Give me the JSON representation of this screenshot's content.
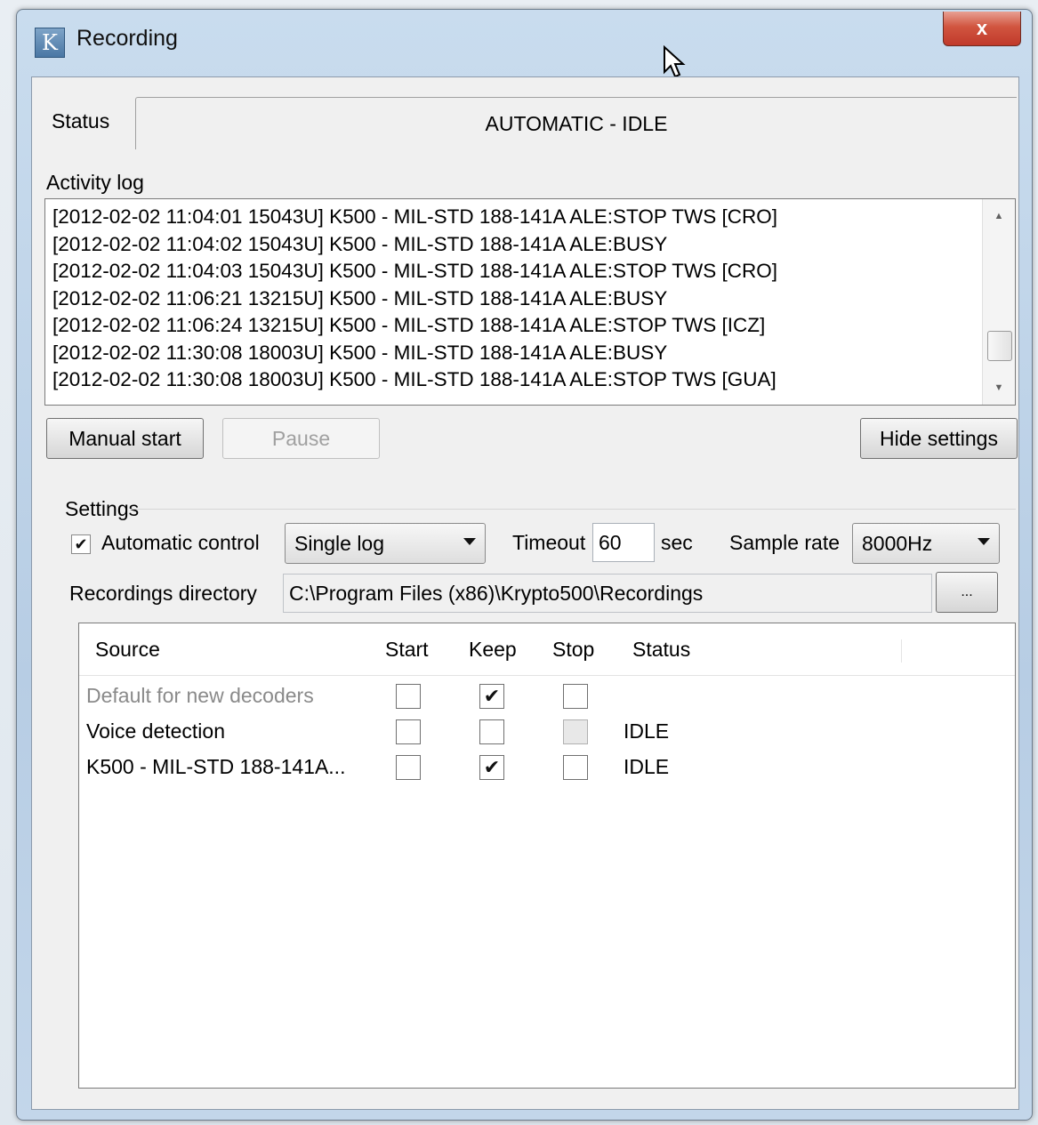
{
  "window": {
    "title": "Recording",
    "app_icon_letter": "K",
    "close_glyph": "x"
  },
  "status": {
    "label": "Status",
    "value": "AUTOMATIC - IDLE"
  },
  "activity_log": {
    "label": "Activity log",
    "lines": [
      "[2012-02-02 11:04:01 15043U] K500 - MIL-STD 188-141A ALE:STOP TWS [CRO]",
      "[2012-02-02 11:04:02 15043U] K500 - MIL-STD 188-141A ALE:BUSY",
      "[2012-02-02 11:04:03 15043U] K500 - MIL-STD 188-141A ALE:STOP TWS [CRO]",
      "[2012-02-02 11:06:21 13215U] K500 - MIL-STD 188-141A ALE:BUSY",
      "[2012-02-02 11:06:24 13215U] K500 - MIL-STD 188-141A ALE:STOP TWS [ICZ]",
      "[2012-02-02 11:30:08 18003U] K500 - MIL-STD 188-141A ALE:BUSY",
      "[2012-02-02 11:30:08 18003U] K500 - MIL-STD 188-141A ALE:STOP TWS [GUA]"
    ]
  },
  "buttons": {
    "manual_start": "Manual start",
    "pause": "Pause",
    "hide_settings": "Hide settings",
    "browse": "..."
  },
  "settings": {
    "label": "Settings",
    "automatic_control_label": "Automatic control",
    "automatic_control_checked": true,
    "log_mode": "Single log",
    "timeout_label": "Timeout",
    "timeout_value": "60",
    "timeout_unit": "sec",
    "sample_rate_label": "Sample rate",
    "sample_rate_value": "8000Hz",
    "recordings_dir_label": "Recordings directory",
    "recordings_dir_value": "C:\\Program Files (x86)\\Krypto500\\Recordings"
  },
  "sources": {
    "columns": [
      "Source",
      "Start",
      "Keep",
      "Stop",
      "Status"
    ],
    "rows": [
      {
        "source": "Default for new decoders",
        "start": false,
        "keep": true,
        "stop": false,
        "status": ""
      },
      {
        "source": "Voice detection",
        "start": false,
        "keep": false,
        "stop": false,
        "status": "IDLE"
      },
      {
        "source": "K500 - MIL-STD 188-141A...",
        "start": false,
        "keep": true,
        "stop": false,
        "status": "IDLE"
      }
    ]
  },
  "glyphs": {
    "check": "✔"
  }
}
